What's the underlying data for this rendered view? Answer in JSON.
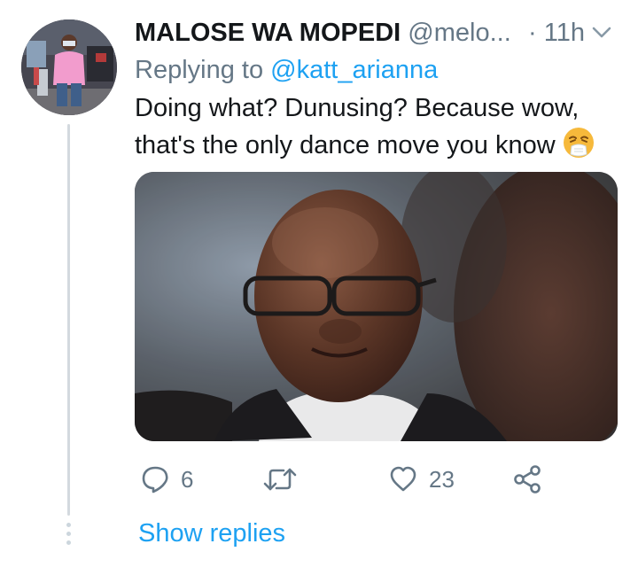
{
  "tweet": {
    "display_name": "MALOSE WA MOPEDI",
    "handle": "@melo...",
    "time": "· 11h",
    "reply_prefix": "Replying to ",
    "reply_handle": "@katt_arianna",
    "text_line1": "Doing what? Dunusing? Because wow,",
    "text_line2": "that's the only dance move you know",
    "emoji": "sneezing-face",
    "media_description_icon": "photo"
  },
  "actions": {
    "reply_count": "6",
    "retweet_count": "",
    "like_count": "23"
  },
  "show_replies_label": "Show replies",
  "colors": {
    "link": "#1da1f2",
    "secondary_text": "#657786",
    "primary_text": "#14171a",
    "thread_line": "#d3d9de"
  }
}
